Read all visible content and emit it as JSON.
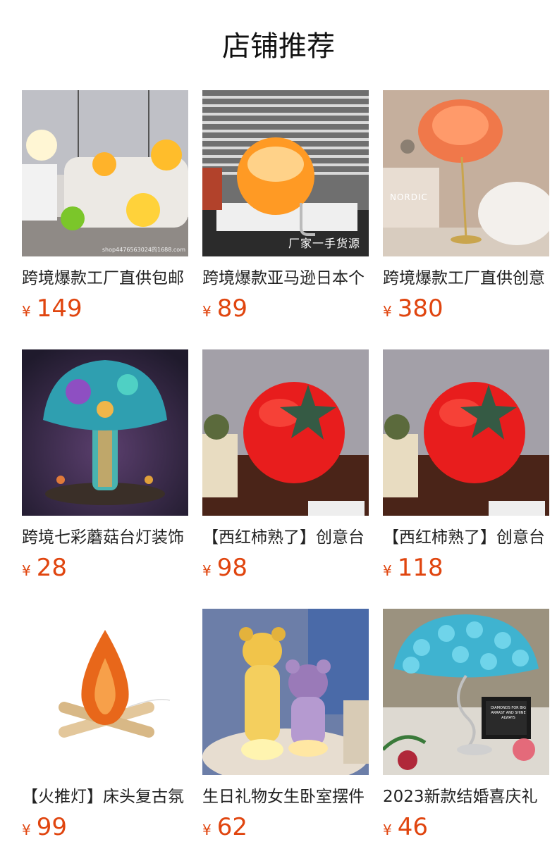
{
  "header": {
    "title": "店铺推荐"
  },
  "currency_symbol": "¥",
  "products": [
    {
      "name": "跨境爆款工厂直供包邮",
      "price": "149",
      "image": "globe-lamps-photo",
      "overlay": "",
      "watermark": "shop4476563024的1688.com"
    },
    {
      "name": "跨境爆款亚马逊日本个",
      "price": "89",
      "image": "orange-globe-lamp-photo",
      "overlay": "厂家一手货源",
      "watermark": ""
    },
    {
      "name": "跨境爆款工厂直供创意",
      "price": "380",
      "image": "feather-floor-lamp-photo",
      "overlay": "NORDIC",
      "watermark": ""
    },
    {
      "name": "跨境七彩蘑菇台灯装饰",
      "price": "28",
      "image": "mushroom-lamp-photo",
      "overlay": "",
      "watermark": ""
    },
    {
      "name": "【西红柿熟了】创意台",
      "price": "98",
      "image": "tomato-lamp-photo",
      "overlay": "",
      "watermark": ""
    },
    {
      "name": "【西红柿熟了】创意台",
      "price": "118",
      "image": "tomato-lamp-photo",
      "overlay": "",
      "watermark": ""
    },
    {
      "name": "【火推灯】床头复古氛",
      "price": "99",
      "image": "campfire-lamp-photo",
      "overlay": "",
      "watermark": ""
    },
    {
      "name": "生日礼物女生卧室摆件",
      "price": "62",
      "image": "bear-lamp-photo",
      "overlay": "",
      "watermark": ""
    },
    {
      "name": "2023新款结婚喜庆礼",
      "price": "46",
      "image": "rose-lamp-photo",
      "overlay": "DIAMONDS FOR BIG ARRAST AND SHINE ALWAYS",
      "watermark": ""
    }
  ],
  "colors": {
    "price": "#e0450f",
    "text": "#222222"
  }
}
